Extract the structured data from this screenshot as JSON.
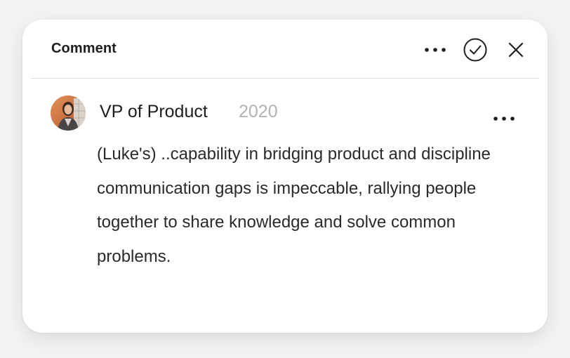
{
  "header": {
    "title": "Comment",
    "more_icon": "more-horizontal-icon",
    "resolve_icon": "check-circle-icon",
    "close_icon": "close-icon"
  },
  "comment": {
    "author": "VP of Product",
    "date": "2020",
    "text": "(Luke's) ..capability in bridging product and discipline communication gaps is impeccable, rallying people together to share knowledge and solve common problems.",
    "more_icon": "more-horizontal-icon"
  },
  "colors": {
    "accent": "#1e1e1e",
    "muted": "#b3b3b3"
  }
}
